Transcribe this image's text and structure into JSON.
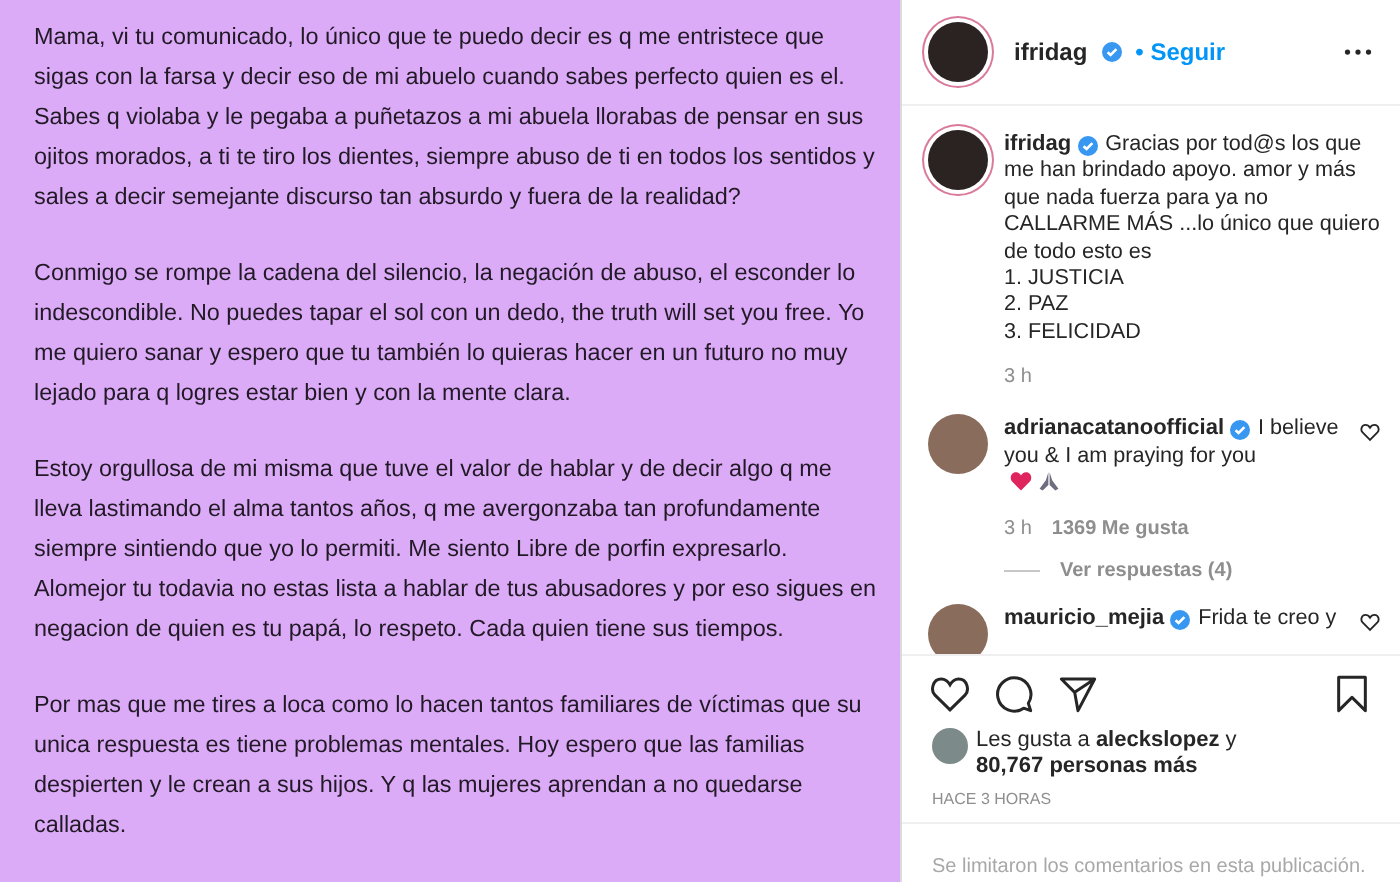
{
  "post_image": {
    "paragraphs": [
      "Mama, vi tu comunicado, lo único que te puedo decir es q me entristece que sigas con la farsa y decir eso de mi abuelo cuando sabes perfecto quien es el. Sabes q violaba y le pegaba a puñetazos a mi abuela llorabas de pensar en sus ojitos morados, a ti te tiro los dientes, siempre abuso de ti en todos los sentidos y sales a decir semejante discurso tan absurdo y fuera de la realidad?",
      "Conmigo se rompe la cadena del silencio, la negación de abuso, el esconder lo indescondible. No puedes tapar el sol con un dedo, the truth will set you free. Yo me quiero sanar y espero que tu también lo quieras hacer en un futuro no muy lejado para q logres estar bien y con la mente clara.",
      "Estoy orgullosa de mi misma que tuve el valor de hablar y de decir algo q me lleva lastimando el alma tantos años, q me avergonzaba tan profundamente siempre sintiendo que yo lo permiti. Me siento Libre de porfin expresarlo. Alomejor tu todavia no estas lista a hablar de tus abusadores y por eso sigues en negacion de quien es tu papá, lo respeto. Cada quien tiene sus tiempos.",
      "Por mas que me tires a loca como lo hacen tantos familiares de víctimas que su unica respuesta es tiene problemas mentales. Hoy espero que las familias despierten y le crean a sus hijos. Y q las mujeres aprendan a no quedarse calladas."
    ]
  },
  "header": {
    "username": "ifridag",
    "verified": true,
    "follow": "• Seguir"
  },
  "caption": {
    "username": "ifridag",
    "verified": true,
    "lines": [
      "Gracias por tod@s los que",
      "me han brindado apoyo. amor y más",
      "que nada fuerza para ya no",
      "CALLARME MÁS ...lo único que quiero",
      "de todo esto es",
      "1. JUSTICIA",
      "2. PAZ",
      "3. FELICIDAD"
    ],
    "time": "3 h"
  },
  "comments": [
    {
      "kind": "emoji",
      "username": "adrianacatanoofficial",
      "verified": true,
      "lines": [
        "I believe",
        "you & I am praying for you"
      ],
      "time": "3 h",
      "likes": "1369 Me gusta",
      "replies": "Ver respuestas (4)"
    },
    {
      "kind": "plain",
      "username": "mauricio_mejia",
      "verified": true,
      "lines": [
        "Frida te creo y"
      ]
    }
  ],
  "actions": {
    "liked": false,
    "saved": false
  },
  "likes": {
    "text": "Les gusta a **aleckslopez** y **80,767 personas más**"
  },
  "timestamp": "HACE 3 HORAS",
  "comments_notice": "Se limitaron los comentarios en esta publicación."
}
